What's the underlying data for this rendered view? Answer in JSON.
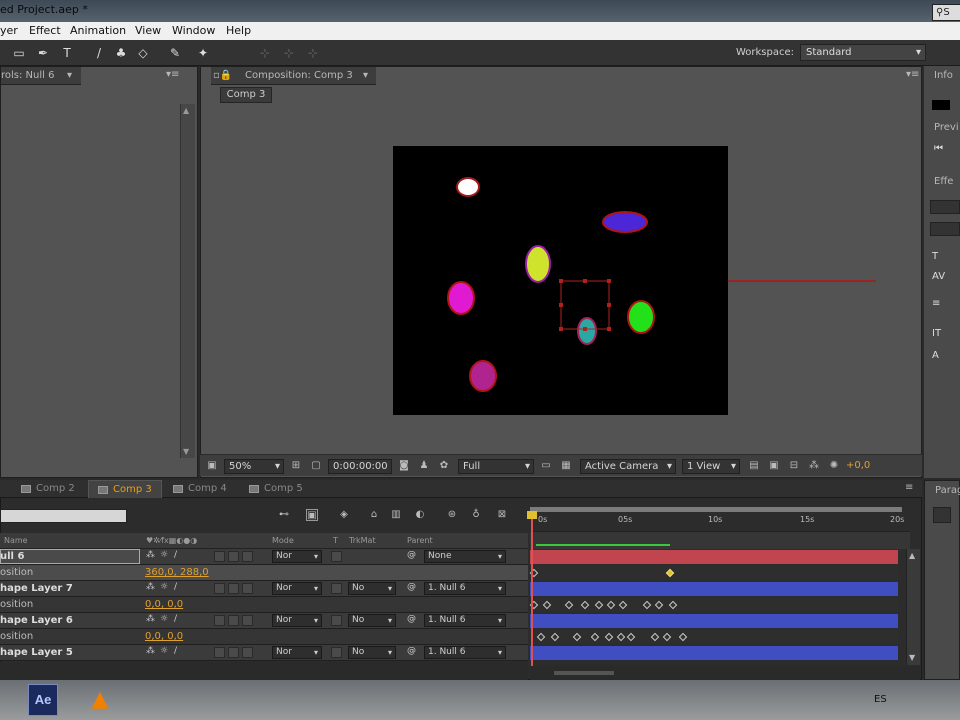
{
  "window": {
    "title": "ed Project.aep *"
  },
  "menu": [
    "yer",
    "Effect",
    "Animation",
    "View",
    "Window",
    "Help"
  ],
  "toolbar": {
    "workspace_label": "Workspace:",
    "workspace_value": "Standard",
    "search_text": "S"
  },
  "effects_panel": {
    "tab_label": "rols: Null 6"
  },
  "comp_panel": {
    "tab_label": "Composition: Comp 3",
    "subtab": "Comp 3",
    "zoom": "50%",
    "timecode": "0:00:00:00",
    "resolution": "Full",
    "camera": "Active Camera",
    "views": "1 View",
    "exposure": "+0,0"
  },
  "right_panel": {
    "info": "Info",
    "preview": "Previ",
    "effects": "Effe",
    "paragraph": "Parag"
  },
  "timeline": {
    "tabs": [
      "Comp 2",
      "Comp 3",
      "Comp 4",
      "Comp 5"
    ],
    "active_tab": "Comp 3",
    "columns": {
      "name": "Name",
      "mode": "Mode",
      "t": "T",
      "trkmat": "TrkMat",
      "parent": "Parent"
    },
    "ruler": [
      "0s",
      "05s",
      "10s",
      "15s",
      "20s"
    ],
    "rows": [
      {
        "kind": "layer",
        "name": "ull 6",
        "mode": "Nor",
        "trkmat": "",
        "parent": "None"
      },
      {
        "kind": "prop",
        "name": "osition",
        "value": "360,0, 288,0"
      },
      {
        "kind": "layer",
        "name": "hape Layer 7",
        "mode": "Nor",
        "trkmat": "No",
        "parent": "1. Null 6"
      },
      {
        "kind": "prop",
        "name": "osition",
        "value": "0,0, 0,0"
      },
      {
        "kind": "layer",
        "name": "hape Layer 6",
        "mode": "Nor",
        "trkmat": "No",
        "parent": "1. Null 6"
      },
      {
        "kind": "prop",
        "name": "osition",
        "value": "0,0, 0,0"
      },
      {
        "kind": "layer",
        "name": "hape Layer 5",
        "mode": "Nor",
        "trkmat": "No",
        "parent": "1. Null 6"
      }
    ]
  },
  "colors": {
    "null_bar": "#c0454f",
    "shape_bar": "#3f4ec0",
    "accent": "#f0a000"
  },
  "taskbar": {
    "app_ae": "Ae",
    "lang": "ES"
  }
}
